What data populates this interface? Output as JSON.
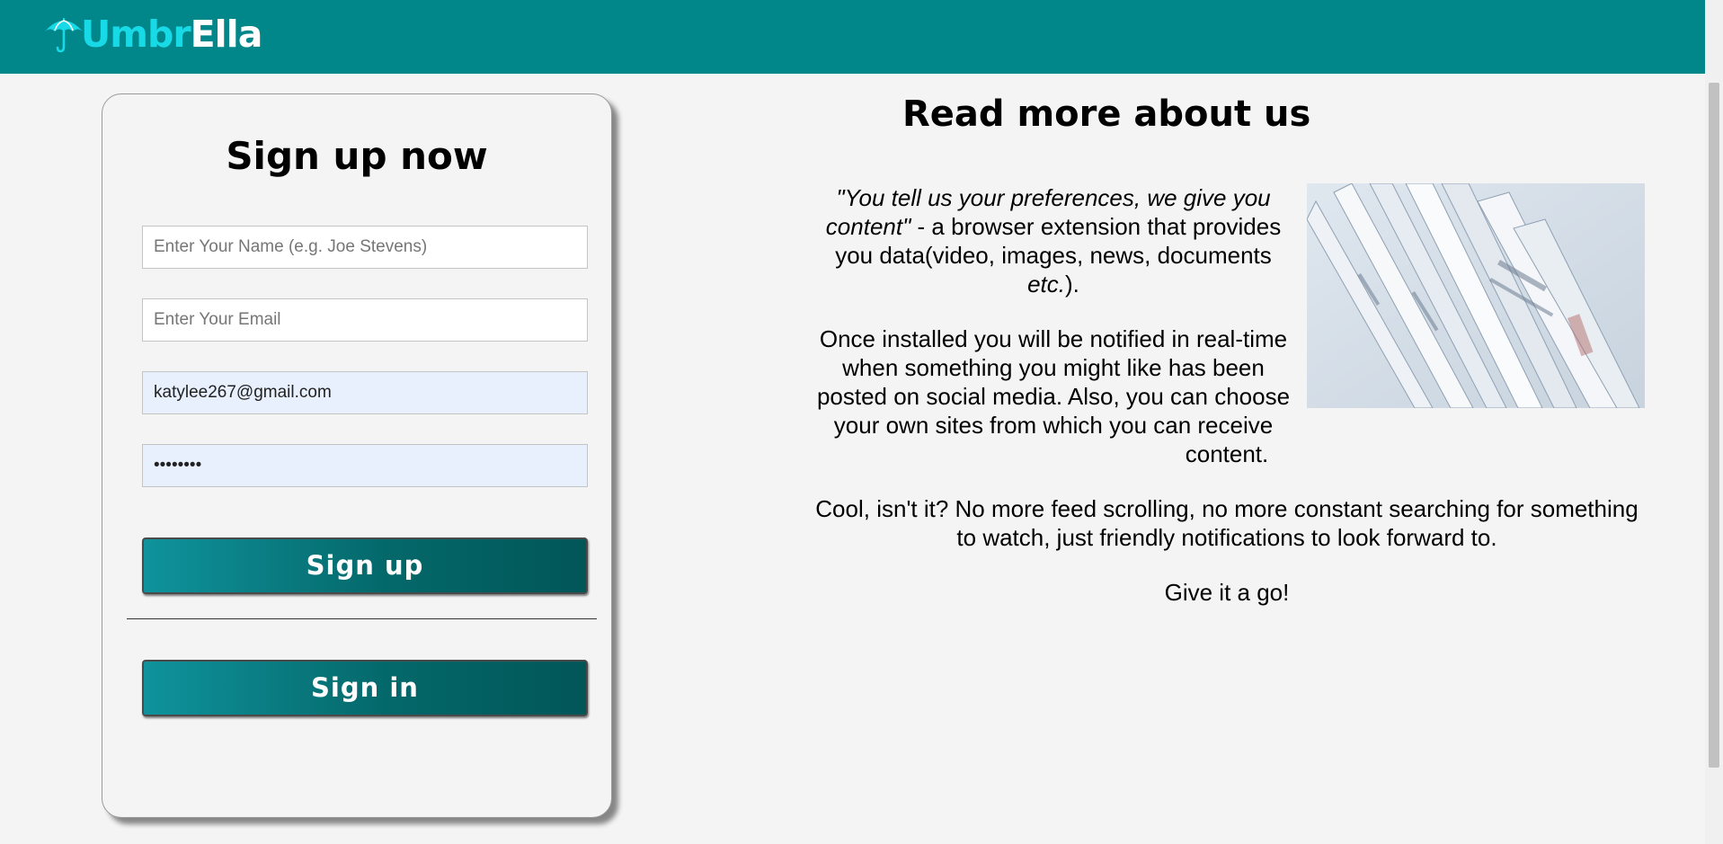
{
  "header": {
    "logo_part1": "Umbr",
    "logo_part2": "Ella",
    "background_color": "#01868a",
    "logo_icon": "umbrella-icon"
  },
  "signup": {
    "title": "Sign up now",
    "name_placeholder": "Enter Your Name (e.g. Joe Stevens)",
    "email_placeholder": "Enter Your Email",
    "email_value": "katylee267@gmail.com",
    "password_value": "••••••••",
    "signup_label": "Sign up",
    "signin_label": "Sign in"
  },
  "about": {
    "title": "Read more about us",
    "quote": "\"You tell us your preferences, we give you content\"",
    "p1_rest": " - a browser extension that provides you data(video, images, news, documents ",
    "p1_etc": "etc.",
    "p1_end": ").",
    "p2": "Once installed you will be notified in real-time when something you might like has been posted on social media. Also, you can choose your own sites from which you can receive content.",
    "p3": "Cool, isn't it? No more feed scrolling, no more constant searching for something to watch, just friendly notifications to look forward to.",
    "p4": "Give it a go!"
  }
}
